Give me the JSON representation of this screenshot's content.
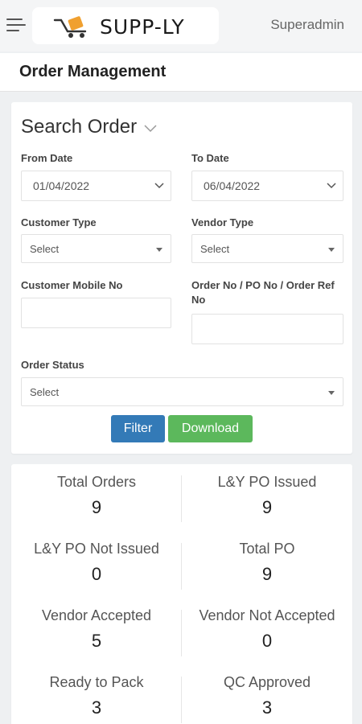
{
  "header": {
    "brand": "SUPP-LY",
    "user_label": "Superadmin"
  },
  "page": {
    "title": "Order Management"
  },
  "search": {
    "title": "Search Order",
    "from_date_label": "From Date",
    "from_date_value": "01/04/2022",
    "to_date_label": "To Date",
    "to_date_value": "06/04/2022",
    "customer_type_label": "Customer Type",
    "customer_type_value": "Select",
    "vendor_type_label": "Vendor Type",
    "vendor_type_value": "Select",
    "customer_mobile_label": "Customer Mobile No",
    "customer_mobile_value": "",
    "order_no_label": "Order No / PO No / Order Ref No",
    "order_no_value": "",
    "order_status_label": "Order Status",
    "order_status_value": "Select",
    "filter_label": "Filter",
    "download_label": "Download"
  },
  "stats": [
    {
      "label": "Total Orders",
      "value": "9"
    },
    {
      "label": "L&Y PO Issued",
      "value": "9"
    },
    {
      "label": "L&Y PO Not Issued",
      "value": "0"
    },
    {
      "label": "Total PO",
      "value": "9"
    },
    {
      "label": "Vendor Accepted",
      "value": "5"
    },
    {
      "label": "Vendor Not Accepted",
      "value": "0"
    },
    {
      "label": "Ready to Pack",
      "value": "3"
    },
    {
      "label": "QC Approved",
      "value": "3"
    }
  ],
  "colors": {
    "filter_button": "#337ab7",
    "download_button": "#5cb85c",
    "logo_accent": "#f0a030"
  },
  "icons": {
    "menu": "hamburger-icon",
    "logo": "truck-box-logo-icon",
    "collapse": "chevron-down-icon"
  }
}
